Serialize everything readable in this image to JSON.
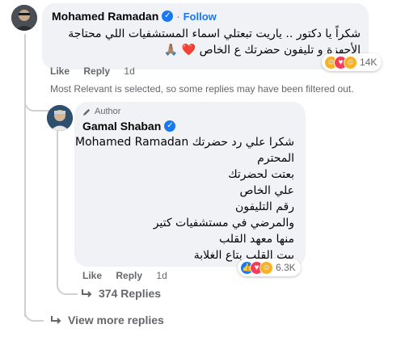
{
  "comment1": {
    "author": "Mohamed Ramadan",
    "follow_label": "Follow",
    "dot": "·",
    "line1": "شكراً يا دكتور .. ياريت تبعتلي اسماء المستشفيات اللي محتاجة",
    "line2": "الأجهزة و تليفون حضرتك ع الخاص ❤️ 🙏🏽",
    "actions": {
      "like": "Like",
      "reply": "Reply",
      "time": "1d"
    },
    "reaction_count": "14K"
  },
  "filter_note": "Most Relevant is selected, so some replies may have been filtered out.",
  "comment2": {
    "badge": "Author",
    "author": "Gamal Shaban",
    "lines": [
      "شكرا علي رد حضرتك Mohamed Ramadan",
      "المحترم",
      "بعتت لحضرتك",
      "علي الخاص",
      "رقم التليفون",
      "والمرضي في مستشفيات كتير",
      "منها معهد القلب",
      "بيت القلب بتاع الغلابة"
    ],
    "actions": {
      "like": "Like",
      "reply": "Reply",
      "time": "1d"
    },
    "reaction_count": "6.3K"
  },
  "replies_link": "374 Replies",
  "more_replies_link": "View more replies",
  "colors": {
    "brand_blue": "#1877f2",
    "bubble_bg": "#f0f2f5",
    "muted": "#65676b"
  },
  "icons": {
    "verified": "verified-badge-icon",
    "author": "pencil-author-icon",
    "reply_arrow": "reply-arrow-icon"
  }
}
